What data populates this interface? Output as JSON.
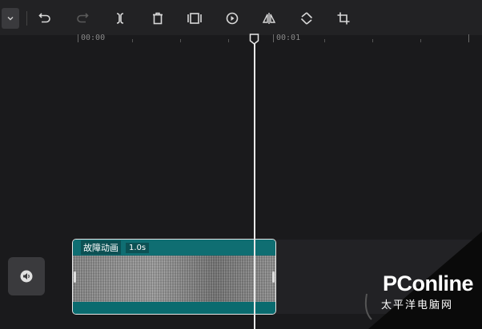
{
  "toolbar": {
    "dropdown": "chevron-down-icon",
    "buttons": [
      "undo-icon",
      "redo-icon",
      "split-icon",
      "delete-icon",
      "freeze-icon",
      "reverse-icon",
      "mirror-icon",
      "rotate-icon",
      "crop-icon"
    ]
  },
  "ruler": {
    "labels": [
      "00:00",
      "00:01"
    ]
  },
  "track": {
    "clip_name": "故障动画",
    "clip_duration": "1.0s",
    "audio_icon": "speaker-icon"
  },
  "watermark": {
    "title": "PConline",
    "subtitle": "太平洋电脑网"
  },
  "colors": {
    "background": "#1a1a1c",
    "toolbar": "#222224",
    "clip_teal": "#0e5a5e",
    "playhead": "#e8e8e8"
  }
}
